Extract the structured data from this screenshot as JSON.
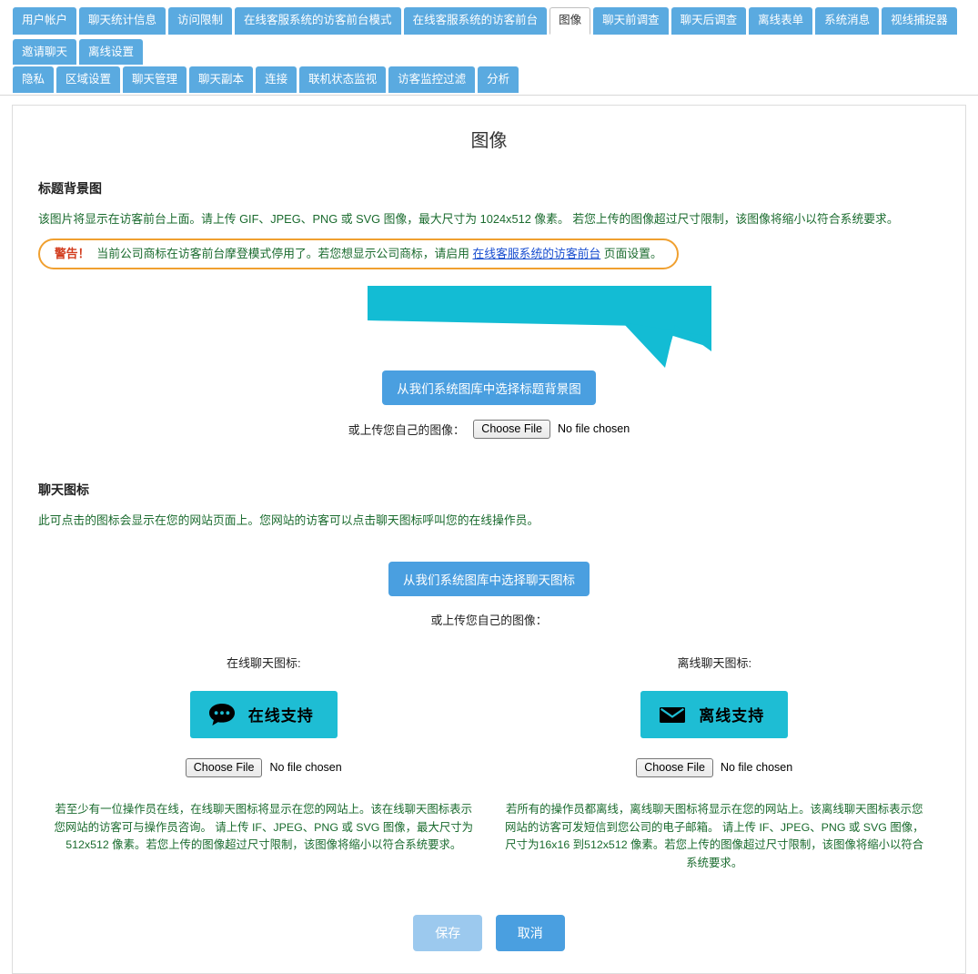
{
  "tabs": {
    "row1": [
      {
        "label": "用户帐户",
        "active": false
      },
      {
        "label": "聊天统计信息",
        "active": false
      },
      {
        "label": "访问限制",
        "active": false
      },
      {
        "label": "在线客服系统的访客前台模式",
        "active": false
      },
      {
        "label": "在线客服系统的访客前台",
        "active": false
      },
      {
        "label": "图像",
        "active": true
      },
      {
        "label": "聊天前调查",
        "active": false
      },
      {
        "label": "聊天后调查",
        "active": false
      },
      {
        "label": "离线表单",
        "active": false
      },
      {
        "label": "系统消息",
        "active": false
      },
      {
        "label": "视线捕捉器",
        "active": false
      },
      {
        "label": "邀请聊天",
        "active": false
      },
      {
        "label": "离线设置",
        "active": false
      }
    ],
    "row2": [
      {
        "label": "隐私",
        "active": false
      },
      {
        "label": "区域设置",
        "active": false
      },
      {
        "label": "聊天管理",
        "active": false
      },
      {
        "label": "聊天副本",
        "active": false
      },
      {
        "label": "连接",
        "active": false
      },
      {
        "label": "联机状态监视",
        "active": false
      },
      {
        "label": "访客监控过滤",
        "active": false
      },
      {
        "label": "分析",
        "active": false
      }
    ]
  },
  "page": {
    "title": "图像"
  },
  "header_bg": {
    "section_title": "标题背景图",
    "description": "该图片将显示在访客前台上面。请上传 GIF、JPEG、PNG 或 SVG 图像，最大尺寸为 1024x512 像素。 若您上传的图像超过尺寸限制，该图像将缩小以符合系统要求。",
    "warning_label": "警告！",
    "warning_text_before": "当前公司商标在访客前台摩登模式停用了。若您想显示公司商标，请启用",
    "warning_link": "在线客服系统的访客前台",
    "warning_text_after": "页面设置。",
    "gallery_button": "从我们系统图库中选择标题背景图",
    "upload_label": "或上传您自己的图像：",
    "choose_file": "Choose File",
    "no_file": "No file chosen",
    "banner_color": "#13bcd4"
  },
  "chat_icon": {
    "section_title": "聊天图标",
    "description": "此可点击的图标会显示在您的网站页面上。您网站的访客可以点击聊天图标呼叫您的在线操作员。",
    "gallery_button": "从我们系统图库中选择聊天图标",
    "upload_label": "或上传您自己的图像：",
    "online": {
      "label": "在线聊天图标:",
      "badge_text": "在线支持",
      "badge_color": "#1ebdd4",
      "icon": "chat-bubble-icon",
      "choose_file": "Choose File",
      "no_file": "No file chosen",
      "description": "若至少有一位操作员在线，在线聊天图标将显示在您的网站上。该在线聊天图标表示您网站的访客可与操作员咨询。 请上传 IF、JPEG、PNG 或 SVG 图像，最大尺寸为512x512 像素。若您上传的图像超过尺寸限制，该图像将缩小以符合系统要求。"
    },
    "offline": {
      "label": "离线聊天图标:",
      "badge_text": "离线支持",
      "badge_color": "#1ebdd4",
      "icon": "envelope-icon",
      "choose_file": "Choose File",
      "no_file": "No file chosen",
      "description": "若所有的操作员都离线，离线聊天图标将显示在您的网站上。该离线聊天图标表示您网站的访客可发短信到您公司的电子邮箱。 请上传 IF、JPEG、PNG 或 SVG 图像，尺寸为16x16 到512x512 像素。若您上传的图像超过尺寸限制，该图像将缩小以符合系统要求。"
    }
  },
  "footer": {
    "save": "保存",
    "cancel": "取消"
  },
  "colors": {
    "tab_blue": "#5aaae0",
    "button_blue": "#4a9fe0",
    "save_disabled": "#9cc9ee",
    "warning_border": "#f0a030",
    "warning_label": "#d23c1e",
    "green_text": "#1a6b2e",
    "cyan": "#1ebdd4"
  }
}
